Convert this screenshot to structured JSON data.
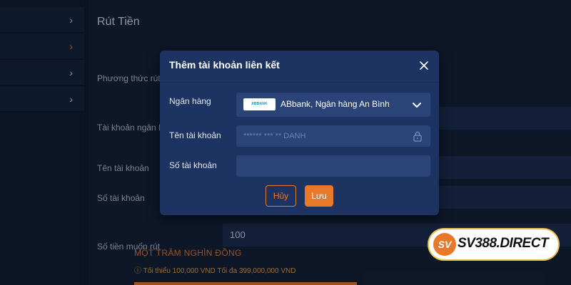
{
  "sidebar": {
    "items": [
      {
        "chevron": "›"
      },
      {
        "chevron": "›"
      },
      {
        "chevron": "›"
      },
      {
        "chevron": "›"
      }
    ]
  },
  "main": {
    "title": "Rút Tiền",
    "labels": {
      "method": "Phương thức rút",
      "bank_account": "Tài khoản ngân h",
      "account_name": "Tên tài khoản",
      "account_number": "Số tài khoản",
      "amount": "Số tiền muốn rút"
    },
    "amount_value": "100",
    "amount_words": "MỘT TRĂM NGHÌN ĐỒNG",
    "amount_hint": "ⓘ Tối thiểu 100,000 VND Tối đa 399,000,000 VND"
  },
  "modal": {
    "title": "Thêm tài khoản liên kết",
    "bank_label": "Ngân hàng",
    "bank_logo_text": "ABBANK",
    "bank_value": "ABbank, Ngân hàng An Bình",
    "account_name_label": "Tên tài khoản",
    "account_name_placeholder": "****** *** ** DANH",
    "account_number_label": "Số tài khoản",
    "account_number_value": "",
    "cancel_label": "Hủy",
    "save_label": "Lưu"
  },
  "watermark": {
    "badge": "SV",
    "text": "SV388.DIRECT"
  },
  "colors": {
    "accent": "#e8792a",
    "modal_bg": "#1d3361",
    "field_bg": "#2a4478",
    "page_bg": "#0e1626"
  },
  "icons": {
    "close": "close-icon",
    "dropdown": "chevron-down-icon",
    "lock": "lock-icon",
    "sidebar_chevron": "chevron-right-icon"
  }
}
